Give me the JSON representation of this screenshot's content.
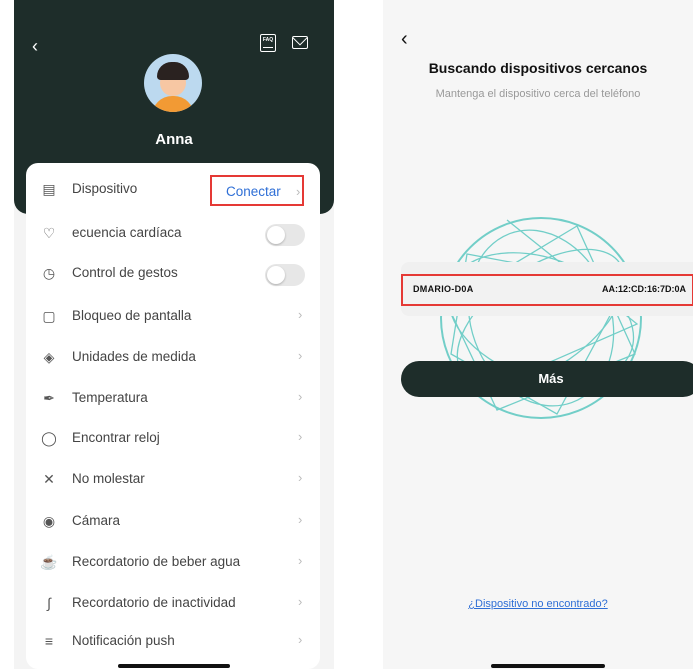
{
  "left": {
    "user_name": "Anna",
    "connect_label": "Conectar",
    "rows": [
      {
        "label": "Dispositivo",
        "icon": "list-icon"
      },
      {
        "label": "ecuencia cardíaca",
        "icon": "heart-rate-icon"
      },
      {
        "label": "Control de gestos",
        "icon": "clock-icon"
      },
      {
        "label": "Bloqueo de pantalla",
        "icon": "lock-icon"
      },
      {
        "label": "Unidades de medida",
        "icon": "ruler-icon"
      },
      {
        "label": "Temperatura",
        "icon": "feather-icon"
      },
      {
        "label": "Encontrar reloj",
        "icon": "find-watch-icon"
      },
      {
        "label": "No molestar",
        "icon": "bell-off-icon"
      },
      {
        "label": "Cámara",
        "icon": "camera-icon"
      },
      {
        "label": "Recordatorio de beber agua",
        "icon": "cup-icon"
      },
      {
        "label": "Recordatorio de inactividad",
        "icon": "seat-icon"
      },
      {
        "label": "Notificación push",
        "icon": "message-icon"
      }
    ],
    "faq_label": "FAQ"
  },
  "right": {
    "title": "Buscando dispositivos cercanos",
    "subtitle": "Mantenga el dispositivo cerca del teléfono",
    "device_name": "DMARIO-D0A",
    "device_mac": "AA:12:CD:16:7D:0A",
    "more_button": "Más",
    "not_found_link": "¿Dispositivo no encontrado?"
  },
  "colors": {
    "header_dark": "#1e2d2a",
    "accent_blue": "#2f6fd6",
    "highlight_red": "#e53935",
    "radar_teal": "#5cc8c0"
  }
}
